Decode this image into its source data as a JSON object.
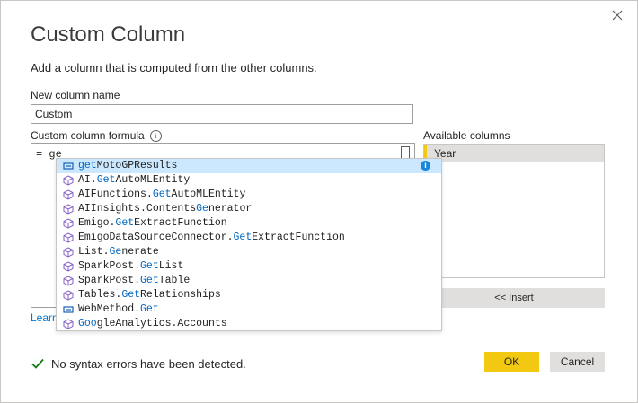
{
  "dialog": {
    "title": "Custom Column",
    "subtitle": "Add a column that is computed from the other columns.",
    "close_icon": "close-icon"
  },
  "name_field": {
    "label": "New column name",
    "value": "Custom"
  },
  "formula": {
    "label": "Custom column formula",
    "info_icon": "info-icon",
    "value": "= ge"
  },
  "learn_link": "Learn",
  "available_columns": {
    "label": "Available columns",
    "items": [
      "Year"
    ],
    "insert_label": "<< Insert"
  },
  "autocomplete": {
    "items": [
      {
        "icon": "function-icon",
        "pre": "",
        "hl": "get",
        "post": "MotoGPResults",
        "selected": true
      },
      {
        "icon": "module-icon",
        "pre": "AI.",
        "hl": "Get",
        "post": "AutoMLEntity"
      },
      {
        "icon": "module-icon",
        "pre": "AIFunctions.",
        "hl": "Get",
        "post": "AutoMLEntity"
      },
      {
        "icon": "module-icon",
        "pre": "AIInsights.Contents",
        "hl": "Ge",
        "post": "nerator"
      },
      {
        "icon": "module-icon",
        "pre": "Emigo.",
        "hl": "Get",
        "post": "ExtractFunction"
      },
      {
        "icon": "module-icon",
        "pre": "EmigoDataSourceConnector.",
        "hl": "Get",
        "post": "ExtractFunction"
      },
      {
        "icon": "module-icon",
        "pre": "List.",
        "hl": "Ge",
        "post": "nerate"
      },
      {
        "icon": "module-icon",
        "pre": "SparkPost.",
        "hl": "Get",
        "post": "List"
      },
      {
        "icon": "module-icon",
        "pre": "SparkPost.",
        "hl": "Get",
        "post": "Table"
      },
      {
        "icon": "module-icon",
        "pre": "Tables.",
        "hl": "Get",
        "post": "Relationships"
      },
      {
        "icon": "function-icon",
        "pre": "WebMethod.",
        "hl": "Get",
        "post": ""
      },
      {
        "icon": "module-icon",
        "pre": "",
        "hl": "Goo",
        "post": "gleAnalytics.Accounts"
      }
    ]
  },
  "status": {
    "icon": "checkmark-icon",
    "text": "No syntax errors have been detected."
  },
  "buttons": {
    "ok": "OK",
    "cancel": "Cancel"
  },
  "colors": {
    "accent": "#f2c811",
    "highlight": "#0066bf",
    "selected_row": "#cce8ff",
    "module_icon": "#8661c5",
    "check": "#107c10"
  }
}
